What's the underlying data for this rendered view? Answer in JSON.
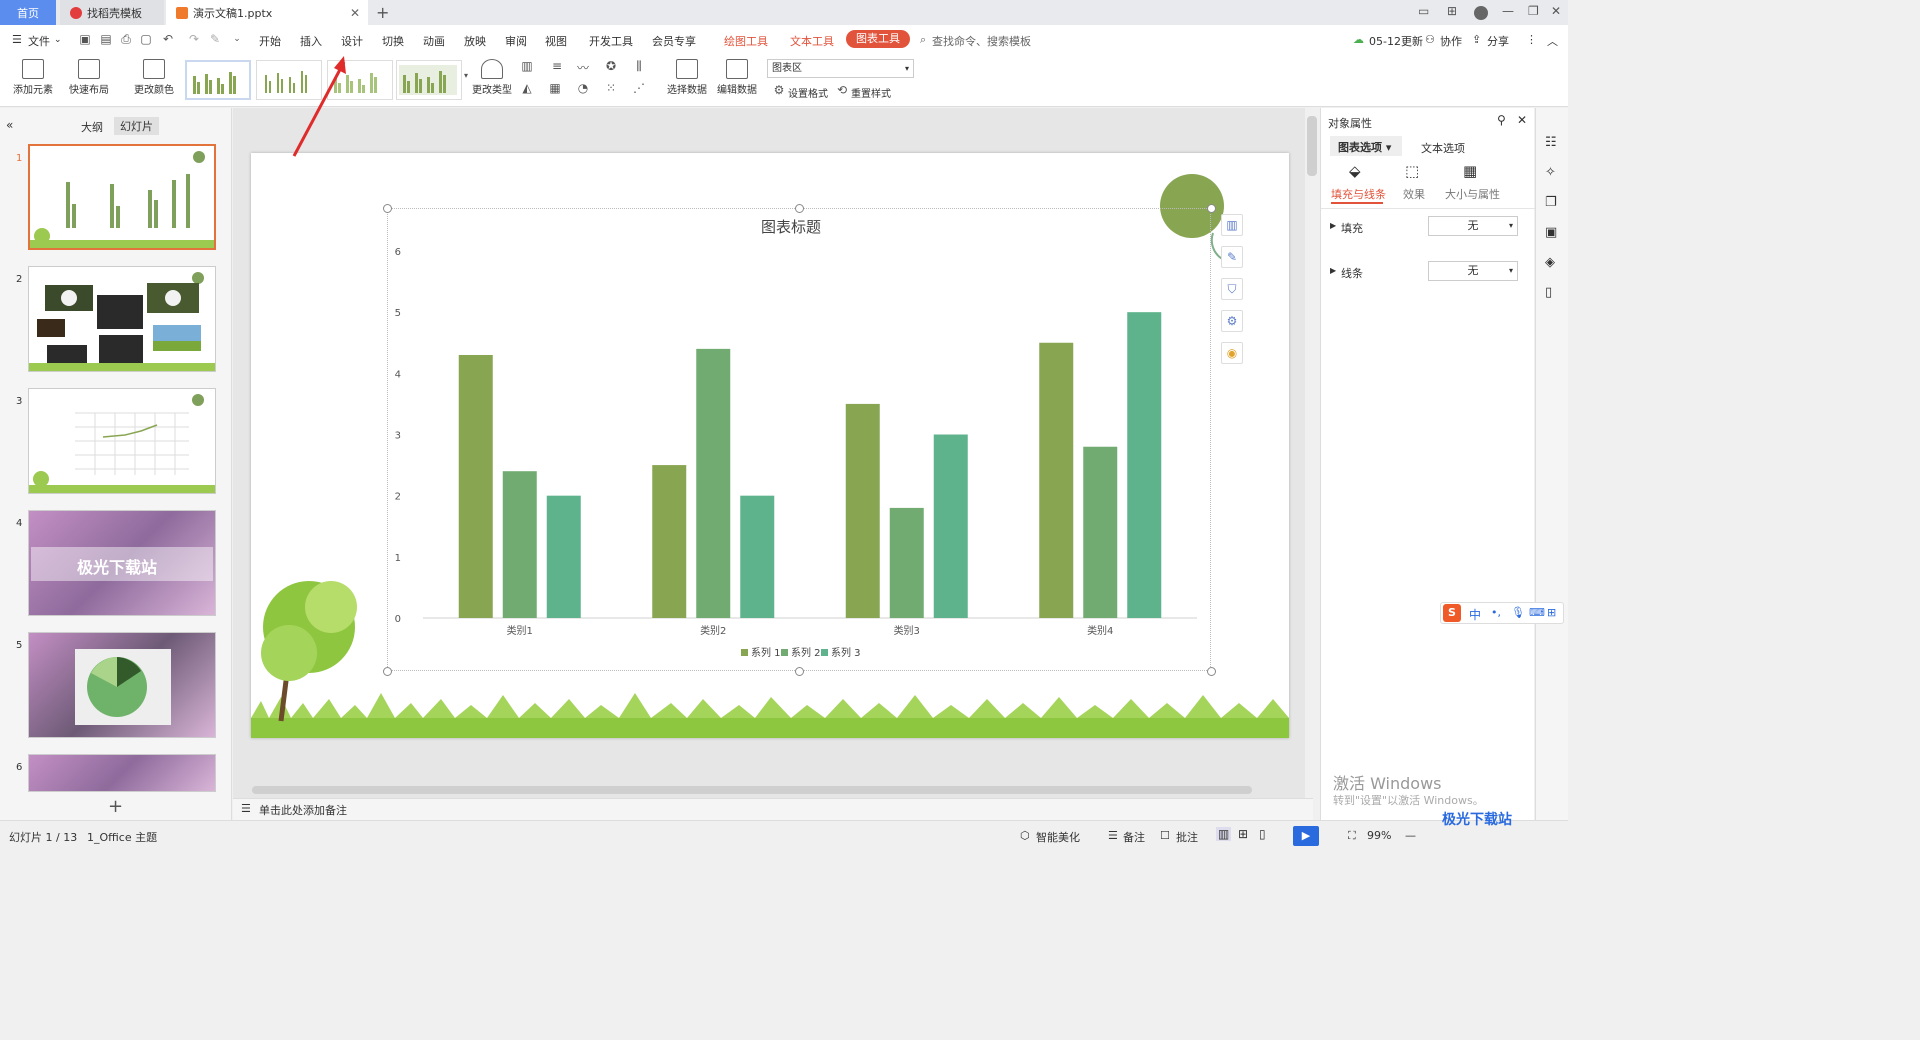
{
  "titlebar": {
    "tabs": [
      {
        "label": "首页"
      },
      {
        "label": "找稻壳模板"
      },
      {
        "label": "演示文稿1.pptx"
      }
    ]
  },
  "menubar": {
    "file_label": "文件",
    "items": [
      "开始",
      "插入",
      "设计",
      "切换",
      "动画",
      "放映",
      "审阅",
      "视图",
      "开发工具",
      "会员专享"
    ],
    "context_tabs": [
      "绘图工具",
      "文本工具"
    ],
    "active_tab": "图表工具",
    "search_placeholder": "查找命令、搜索模板",
    "update_label": "05-12更新",
    "collab_label": "协作",
    "share_label": "分享"
  },
  "ribbon": {
    "add_element": "添加元素",
    "quick_layout": "快速布局",
    "change_color": "更改颜色",
    "change_type": "更改类型",
    "select_data": "选择数据",
    "edit_data": "编辑数据",
    "chart_area_combo": "图表区",
    "set_format": "设置格式",
    "reset_style": "重置样式"
  },
  "leftpanel": {
    "outline_tab": "大纲",
    "slides_tab": "幻灯片",
    "slide_numbers": [
      "1",
      "2",
      "3",
      "4",
      "5",
      "6"
    ],
    "slide4_title": "极光下载站",
    "add_slide": "+"
  },
  "notes": {
    "placeholder": "单击此处添加备注"
  },
  "chart_data": {
    "type": "bar",
    "title": "图表标题",
    "categories": [
      "类别1",
      "类别2",
      "类别3",
      "类别4"
    ],
    "series": [
      {
        "name": "系列 1",
        "values": [
          4.3,
          2.5,
          3.5,
          4.5
        ],
        "color": "#88a552"
      },
      {
        "name": "系列 2",
        "values": [
          2.4,
          4.4,
          1.8,
          2.8
        ],
        "color": "#72ab72"
      },
      {
        "name": "系列 3",
        "values": [
          2.0,
          2.0,
          3.0,
          5.0
        ],
        "color": "#5fb38c"
      }
    ],
    "yticks": [
      "0",
      "1",
      "2",
      "3",
      "4",
      "5",
      "6"
    ],
    "ylim": [
      0,
      6
    ],
    "legend": "bottom",
    "grid": false
  },
  "rightpanel": {
    "title": "对象属性",
    "tabs": [
      "图表选项",
      "文本选项"
    ],
    "subtabs": [
      "填充与线条",
      "效果",
      "大小与属性"
    ],
    "fill_label": "填充",
    "fill_value": "无",
    "line_label": "线条",
    "line_value": "无",
    "watermark_title": "激活 Windows",
    "watermark_sub": "转到\"设置\"以激活 Windows。"
  },
  "statusbar": {
    "slide_info": "幻灯片 1 / 13",
    "theme": "1_Office 主题",
    "beautify": "智能美化",
    "notes_btn": "备注",
    "comments_btn": "批注",
    "zoom": "99%"
  },
  "ime": {
    "label": "中"
  },
  "brand_watermark": "极光下载站",
  "colors": {
    "accent": "#e2533b",
    "home_tab": "#5b8def",
    "selection": "#e2733b"
  }
}
